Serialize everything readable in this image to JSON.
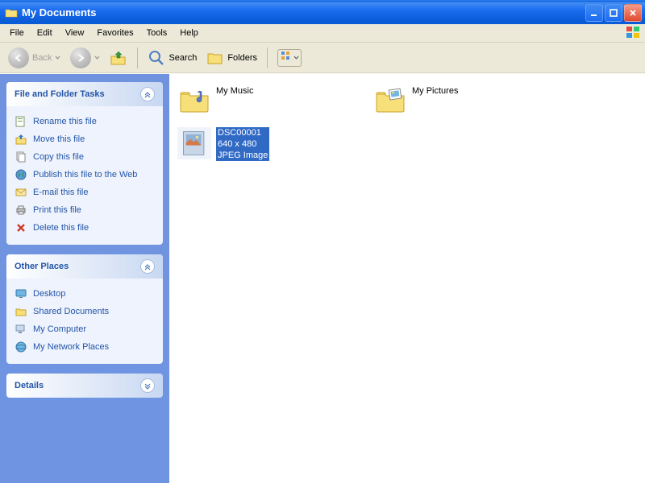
{
  "window": {
    "title": "My Documents"
  },
  "menu": {
    "file": "File",
    "edit": "Edit",
    "view": "View",
    "favorites": "Favorites",
    "tools": "Tools",
    "help": "Help"
  },
  "toolbar": {
    "back": "Back",
    "search": "Search",
    "folders": "Folders"
  },
  "panels": {
    "tasks": {
      "title": "File and Folder Tasks",
      "rename": "Rename this file",
      "move": "Move this file",
      "copy": "Copy this file",
      "publish": "Publish this file to the Web",
      "email": "E-mail this file",
      "print": "Print this file",
      "delete": "Delete this file"
    },
    "places": {
      "title": "Other Places",
      "desktop": "Desktop",
      "shared": "Shared Documents",
      "mycomputer": "My Computer",
      "network": "My Network Places"
    },
    "details": {
      "title": "Details"
    }
  },
  "items": {
    "mymusic": {
      "name": "My Music"
    },
    "mypictures": {
      "name": "My Pictures"
    },
    "selected": {
      "name": "DSC00001",
      "dims": "640 x 480",
      "type": "JPEG Image"
    }
  }
}
